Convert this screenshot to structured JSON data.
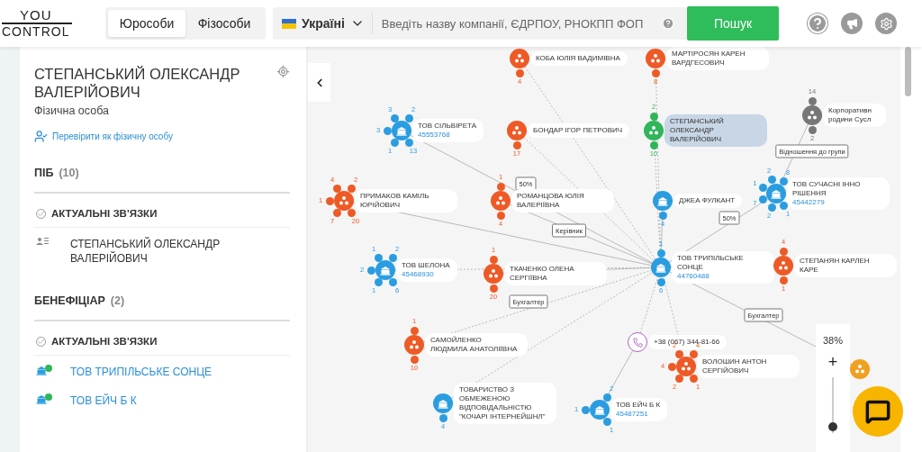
{
  "header": {
    "logo": [
      "YOU",
      "CONTROL"
    ],
    "tabs": [
      {
        "label": "Юрособи",
        "selected": true
      },
      {
        "label": "Фізособи",
        "selected": false
      }
    ],
    "country": "Україні",
    "search": {
      "placeholder": "Введіть назву компанії, ЄДРПОУ, РНОКПП ФОП"
    },
    "search_button": "Пошук"
  },
  "profile": {
    "name": "СТЕПАНСЬКИЙ ОЛЕКСАНДР ВАЛЕРІЙОВИЧ",
    "type": "Фізична особа",
    "check_link": "Перевірити як фізичну особу",
    "sections": [
      {
        "title": "ПІБ",
        "count": "(10)",
        "filter": "АКТУАЛЬНІ ЗВ'ЯЗКИ",
        "items": [
          {
            "kind": "person",
            "label": "СТЕПАНСЬКИЙ ОЛЕКСАНДР ВАЛЕРІЙОВИЧ"
          }
        ]
      },
      {
        "title": "БЕНЕФІЦІАР",
        "count": "(2)",
        "filter": "АКТУАЛЬНІ ЗВ'ЯЗКИ",
        "items": [
          {
            "kind": "company",
            "label": "ТОВ ТРИПІЛЬСЬКЕ СОНЦЕ"
          },
          {
            "kind": "company",
            "label": "ТОВ ЕЙЧ Б К"
          }
        ]
      }
    ]
  },
  "graph": {
    "nodes": [
      {
        "kind": "person",
        "label": "КОБА ЮЛІЯ ВАДИМІВНА",
        "selected": false,
        "counts": [
          "4"
        ]
      },
      {
        "kind": "person",
        "label": "МАРТІРОСЯН КАРЕН ВАРДГЕСОВИЧ",
        "selected": false,
        "counts": [
          "8"
        ]
      },
      {
        "kind": "company",
        "label": "ТОВ СІЛЬВІРЕТА",
        "code": "45553768",
        "selected": false,
        "counts": [
          "3",
          "2",
          "3",
          "1",
          "13"
        ]
      },
      {
        "kind": "person",
        "label": "БОНДАР ІГОР ПЕТРОВИЧ",
        "selected": false,
        "counts": [
          "17"
        ]
      },
      {
        "kind": "person",
        "label": "СТЕПАНСЬКИЙ ОЛЕКСАНДР ВАЛЕРІЙОВИЧ",
        "selected": true,
        "counts": [
          "2",
          "10"
        ]
      },
      {
        "kind": "group",
        "label": "Корпоративн родини Сусл",
        "selected": false,
        "counts": [
          "14",
          "2"
        ]
      },
      {
        "kind": "person",
        "label": "ПРИМАКОВ КАМІЛЬ ЮРІЙОВИЧ",
        "selected": false,
        "counts": [
          "4",
          "2",
          "1",
          "7",
          "20"
        ]
      },
      {
        "kind": "person",
        "label": "РОМАНЦОВА ЮЛІЯ ВАЛЕРІЇВНА",
        "selected": false,
        "counts": [
          "1",
          "4"
        ]
      },
      {
        "kind": "company",
        "label": "ДЖЕА ФУЛКАНТ",
        "selected": false,
        "counts": [
          "4"
        ]
      },
      {
        "kind": "company",
        "label": "ТОВ СУЧАСНІ ІННО РІШЕННЯ",
        "code": "45442279",
        "selected": false,
        "counts": [
          "2",
          "8",
          "1",
          "7",
          "1",
          "2"
        ]
      },
      {
        "kind": "company",
        "label": "ТОВ ШЕЛОНА",
        "code": "45468930",
        "selected": false,
        "counts": [
          "1",
          "2",
          "2",
          "1",
          "6"
        ]
      },
      {
        "kind": "person",
        "label": "ТКАЧЕНКО ОЛЕНА СЕРГІЇВНА",
        "selected": false,
        "counts": [
          "1",
          "20"
        ]
      },
      {
        "kind": "company",
        "label": "ТОВ ТРИПІЛЬСЬКЕ СОНЦЕ",
        "code": "44760488",
        "selected": false,
        "counts": [
          "1",
          "6"
        ]
      },
      {
        "kind": "person",
        "label": "СТЕПАНЯН КАРЛЕН КАРЕ",
        "selected": false,
        "counts": [
          "4",
          "1"
        ]
      },
      {
        "kind": "person",
        "label": "САМОЙЛЕНКО ЛЮДМИЛА АНАТОЛІЇВНА",
        "selected": false,
        "counts": [
          "1",
          "10"
        ]
      },
      {
        "kind": "phone",
        "label": "+38 (067) 344-81-66",
        "selected": false
      },
      {
        "kind": "person",
        "label": "ВОЛОШИН АНТОН СЕРГІЙОВИЧ",
        "selected": false,
        "counts": [
          "2",
          "4",
          "4",
          "2",
          "1"
        ]
      },
      {
        "kind": "company",
        "label": "ТОВАРИСТВО З ОБМЕЖЕНОЮ ВІДПОВІДАЛЬНІСТЮ \"КОЧАРІ ІНТЕРНЕЙШНЛ\"",
        "selected": false,
        "counts": [
          "4"
        ]
      },
      {
        "kind": "company",
        "label": "ТОВ ЕЙЧ Б К",
        "code": "45487251",
        "selected": false,
        "counts": [
          "2",
          "1",
          "1"
        ]
      },
      {
        "kind": "partner",
        "selected": false
      }
    ],
    "edge_labels": [
      "50%",
      "50%",
      "Керівник",
      "Бухгалтер",
      "Відношення до групи",
      "Бухгалтер"
    ]
  },
  "zoom": {
    "reading": "38%",
    "plus": "+",
    "level": 0.12
  }
}
